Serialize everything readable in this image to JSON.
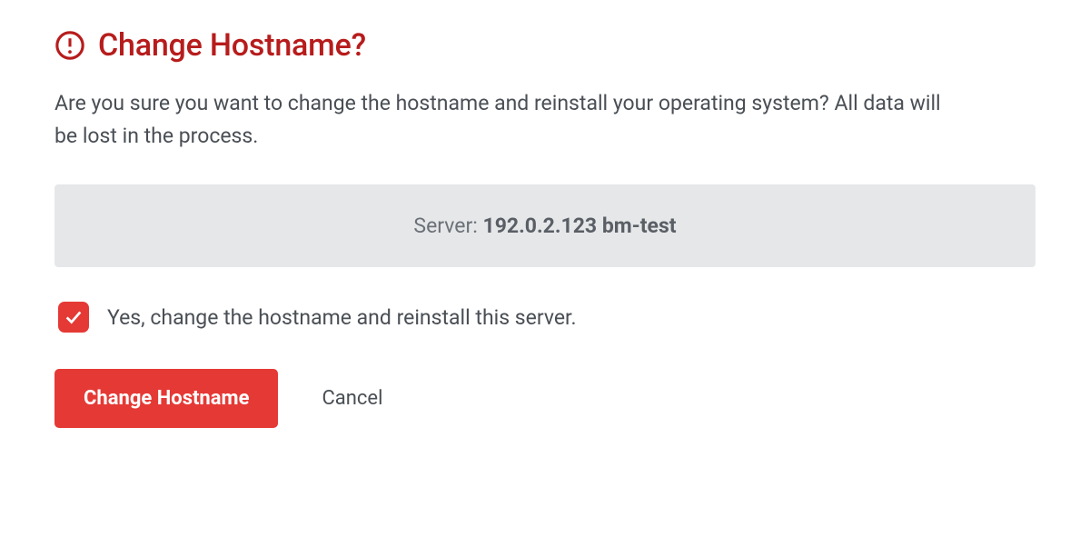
{
  "dialog": {
    "title": "Change Hostname?",
    "message": "Are you sure you want to change the hostname and reinstall your operating system? All data will be lost in the process.",
    "server_label": "Server: ",
    "server_value": "192.0.2.123 bm-test",
    "confirm_checkbox": {
      "checked": true,
      "label": "Yes, change the hostname and reinstall this server."
    },
    "primary_button": "Change Hostname",
    "cancel_button": "Cancel"
  }
}
